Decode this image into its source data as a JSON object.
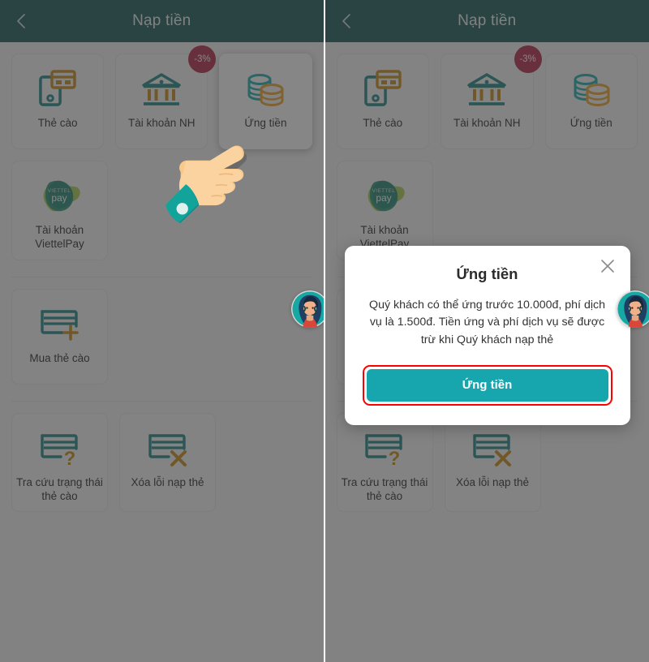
{
  "app": {
    "header": {
      "title": "Nạp tiền",
      "back_icon": "chevron-left-icon",
      "bg_color": "#0f5350"
    },
    "accent_color": "#17a6ae",
    "badge_color": "#b01b3d",
    "highlight_outline_color": "#ff0000"
  },
  "top_row": [
    {
      "id": "the-cao",
      "label": "Thẻ cào",
      "icon": "scratch-card-icon",
      "badge": null
    },
    {
      "id": "tai-khoan-nh",
      "label": "Tài khoản NH",
      "icon": "bank-icon",
      "badge": "-3%"
    },
    {
      "id": "ung-tien",
      "label": "Ứng tiền",
      "icon": "coins-icon",
      "badge": null
    }
  ],
  "second_row": [
    {
      "id": "tai-khoan-viettelpay",
      "label": "Tài khoản\nViettelPay",
      "icon": "viettelpay-logo-icon",
      "badge": null
    }
  ],
  "third_row": [
    {
      "id": "mua-the-cao",
      "label": "Mua thẻ cào",
      "icon": "card-plus-icon",
      "badge": null
    }
  ],
  "fourth_row": [
    {
      "id": "tra-cuu-trang-thai-the-cao",
      "label": "Tra cứu trạng thái\nthẻ cào",
      "icon": "card-question-icon",
      "badge": null
    },
    {
      "id": "xoa-loi-nap-the",
      "label": "Xóa lỗi nạp thẻ",
      "icon": "card-error-icon",
      "badge": null
    }
  ],
  "modal": {
    "title": "Ứng tiền",
    "body": "Quý khách có thể ứng trước 10.000đ, phí dịch vụ là 1.500đ. Tiền ứng và phí dịch vụ sẽ được trừ khi Quý khách nạp thẻ",
    "confirm_label": "Ứng tiền",
    "close_icon": "close-icon"
  },
  "support": {
    "avatar_icon": "support-agent-avatar"
  },
  "cursor": {
    "icon": "pointing-hand-cursor"
  }
}
